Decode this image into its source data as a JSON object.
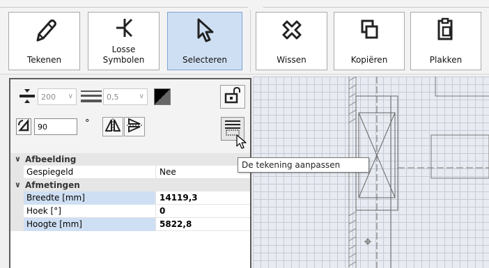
{
  "ribbon": {
    "buttons": [
      {
        "id": "tekenen",
        "label": "Tekenen",
        "icon": "pencil-icon",
        "active": false
      },
      {
        "id": "losse-symbolen",
        "label_line1": "Losse",
        "label_line2": "Symbolen",
        "icon": "symbol-icon",
        "active": false
      },
      {
        "id": "selecteren",
        "label": "Selecteren",
        "icon": "pointer-icon",
        "active": true
      },
      {
        "id": "wissen",
        "label": "Wissen",
        "icon": "erase-x-icon",
        "active": false
      },
      {
        "id": "kopieren",
        "label": "Kopiëren",
        "icon": "copy-icon",
        "active": false
      },
      {
        "id": "plakken",
        "label": "Plakken",
        "icon": "paste-icon",
        "active": false
      }
    ]
  },
  "toolbar": {
    "line_width_value": "200",
    "line_thickness_value": "0,5",
    "rotation_value": "90",
    "degree_symbol": "°"
  },
  "properties": {
    "categories": [
      {
        "label": "Afbeelding",
        "rows": [
          {
            "name": "Gespiegeld",
            "value": "Nee",
            "bold": false
          }
        ]
      },
      {
        "label": "Afmetingen",
        "rows": [
          {
            "name": "Breedte [mm]",
            "value": "14119,3",
            "bold": true
          },
          {
            "name": "Hoek [°]",
            "value": "0",
            "bold": true
          },
          {
            "name": "Hoogte [mm]",
            "value": "5822,8",
            "bold": true
          }
        ]
      }
    ]
  },
  "tooltip": {
    "text": "De tekening aanpassen"
  },
  "colors": {
    "active_button": "#cfdff3",
    "panel_border": "#5b5b5b",
    "canvas_bg": "#e8ebf1"
  }
}
